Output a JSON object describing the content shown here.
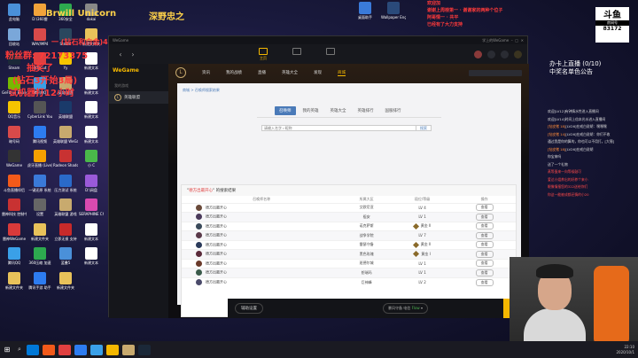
{
  "desktop": {
    "icons": [
      {
        "label": "此电脑",
        "color": "#4a90d9"
      },
      {
        "label": "D:\\360雷",
        "color": "#f2a33a"
      },
      {
        "label": "360安全",
        "color": "#2da94f"
      },
      {
        "label": "dakai",
        "color": "#888"
      },
      {
        "label": "回收站",
        "color": "#7aa7d9"
      },
      {
        "label": "WAV/MP4",
        "color": "#d94a4a"
      },
      {
        "label": "Steam",
        "color": "#2a475e"
      },
      {
        "label": "新建文件夹",
        "color": "#e8c25a"
      },
      {
        "label": "Steam",
        "color": "#1b2838"
      },
      {
        "label": "易看Cut",
        "color": "#e04040"
      },
      {
        "label": "Yy",
        "color": "#f5c400"
      },
      {
        "label": "新建文本",
        "color": "#fff"
      },
      {
        "label": "GeForce Experience",
        "color": "#76b900"
      },
      {
        "label": "腾讯QQ",
        "color": "#3aa0e8"
      },
      {
        "label": "英雄联盟",
        "color": "#c8aa6e"
      },
      {
        "label": "新建文本",
        "color": "#fff"
      },
      {
        "label": "QQ音乐",
        "color": "#f5c400"
      },
      {
        "label": "CyberLink YouCam 7",
        "color": "#555"
      },
      {
        "label": "英雄联盟",
        "color": "#1a3a6a"
      },
      {
        "label": "新建文本",
        "color": "#fff"
      },
      {
        "label": "暗号码",
        "color": "#d94a4a"
      },
      {
        "label": "腾讯视频",
        "color": "#2d7cf0"
      },
      {
        "label": "英雄联盟 WeGame版",
        "color": "#c8aa6e"
      },
      {
        "label": "新建文本",
        "color": "#fff"
      },
      {
        "label": "WeGame",
        "color": "#333"
      },
      {
        "label": "虎牙直播 (Live)",
        "color": "#f5a000"
      },
      {
        "label": "Radeon Shadow",
        "color": "#c83232"
      },
      {
        "label": "小 C",
        "color": "#4ab84a"
      },
      {
        "label": "斗鱼直播伴侣",
        "color": "#f25a1a"
      },
      {
        "label": "一键还原 系统",
        "color": "#3a7ad9"
      },
      {
        "label": "压力测试 系统",
        "color": "#2a6ac9"
      },
      {
        "label": "D:\\网盘",
        "color": "#9a5ad9"
      },
      {
        "label": "雷神科技 控制中心",
        "color": "#c83232"
      },
      {
        "label": "设置",
        "color": "#666"
      },
      {
        "label": "英雄联盟 游戏",
        "color": "#c8aa6e"
      },
      {
        "label": "SERAPHINE Choiha",
        "color": "#d94ab0"
      },
      {
        "label": "雷神WeGame",
        "color": "#d93a3a"
      },
      {
        "label": "新建文件夹",
        "color": "#e8c25a"
      },
      {
        "label": "立即无损 支持",
        "color": "#c82a2a"
      },
      {
        "label": "新建文本",
        "color": "#fff"
      },
      {
        "label": "腾讯QQ",
        "color": "#3aa0e8"
      },
      {
        "label": "360压缩 加速",
        "color": "#2da94f"
      },
      {
        "label": "蓝叠5",
        "color": "#4a90d9"
      },
      {
        "label": "新建文本",
        "color": "#fff"
      },
      {
        "label": "新建文件夹",
        "color": "#e8c25a"
      },
      {
        "label": "腾讯手游 助手",
        "color": "#2d7cf0"
      },
      {
        "label": "新建文件夹",
        "color": "#e8c25a"
      }
    ],
    "right_icons": [
      {
        "label": "桌面助手",
        "color": "#3a7ad9"
      },
      {
        "label": "Wallpaper Engine",
        "color": "#2a4a7a"
      }
    ]
  },
  "overlay": {
    "line1": "Brwill  Unicorn",
    "line2": "深野忠之",
    "line3": "斗鱼",
    "line4": "粉丝群: 72173375",
    "line5": "抽奖了",
    "line6": "(钻石3开始3局)",
    "line7": "试机器打12小时",
    "line8": "新手必看",
    "top_notice": "一 (钻石和白金)4",
    "fans_notice": [
      "欢迎加",
      "谢谢上周榜第一 · 谢谢家的两种个位子",
      "阿哥情一 · 共平",
      "已经有了大力支持"
    ]
  },
  "wegame": {
    "title": "WeGame",
    "window_user": "学上的WeGame",
    "nav": {
      "back": "‹",
      "forward": "›"
    },
    "tabs": [
      {
        "label": "主页",
        "active": true
      },
      {
        "label": "",
        "active": false
      },
      {
        "label": "",
        "active": false
      }
    ],
    "side": {
      "brand": "WeGame",
      "section": "我的游戏",
      "game": "英雄联盟"
    },
    "lol_menu": {
      "items": [
        "资讯",
        "我的战绩",
        "直播",
        "英雄大全",
        "发现",
        "商城"
      ],
      "active_index": 5
    },
    "panel": {
      "breadcrumb": "商城 > 召唤师搜索结果",
      "subtabs": [
        "召唤师",
        "我的英雄",
        "英雄大全",
        "英雄排行",
        "国服排行"
      ],
      "active_subtab": 0,
      "search_placeholder": "请输入名字 • 昵称",
      "search_button": "搜索",
      "result_title_prefix": "\"",
      "query": "德方出最开心",
      "result_title_suffix": "\" 的搜索结果",
      "columns": [
        "召唤师名称",
        "所属大区",
        "段位/等级",
        "操作"
      ],
      "rows": [
        {
          "name": "德方出最开心",
          "region": "艾欧尼亚",
          "rank": "LV 4",
          "has_rank_icon": false,
          "avatar": "#6a4a3a",
          "action": "查看"
        },
        {
          "name": "德方出最开心",
          "region": "祖安",
          "rank": "LV 1",
          "has_rank_icon": false,
          "avatar": "#4a3a5a",
          "action": "查看"
        },
        {
          "name": "德方出最开心",
          "region": "诺克萨斯",
          "rank": "黄金 II",
          "has_rank_icon": true,
          "avatar": "#3a4a5a",
          "action": "查看"
        },
        {
          "name": "德方出最开心",
          "region": "战争学院",
          "rank": "LV 7",
          "has_rank_icon": false,
          "avatar": "#5a3a4a",
          "action": "查看"
        },
        {
          "name": "德方出最开心",
          "region": "雷瑟守备",
          "rank": "黄金 II",
          "has_rank_icon": true,
          "avatar": "#2a3a5a",
          "action": "查看"
        },
        {
          "name": "德方出最开心",
          "region": "黑色玫瑰",
          "rank": "黄金 I",
          "has_rank_icon": true,
          "avatar": "#5a2a3a",
          "action": "查看"
        },
        {
          "name": "德方出最开心",
          "region": "班德尔城",
          "rank": "LV 1",
          "has_rank_icon": false,
          "avatar": "#6a3a2a",
          "action": "查看"
        },
        {
          "name": "德方出最开心",
          "region": "恕瑞玛",
          "rank": "LV 1",
          "has_rank_icon": false,
          "avatar": "#3a5a4a",
          "action": "查看"
        },
        {
          "name": "德方出最开心",
          "region": "巨神峰",
          "rank": "LV 2",
          "has_rank_icon": false,
          "avatar": "#4a4a6a",
          "action": "查看"
        }
      ]
    },
    "footer": {
      "assist": "辅助设置",
      "region": "暴风守备",
      "region_status": "电信",
      "region_ok": "Flow",
      "start": "启动"
    }
  },
  "stream": {
    "platform": "斗鱼",
    "room_label": "房间号",
    "room_no": "83172",
    "announce1": "办卡上直播 (0/10)",
    "announce2": "中奖名单色公告",
    "messages": [
      {
        "u": "",
        "t": "欢迎[LV12]有钟情水性进入直播间"
      },
      {
        "u": "",
        "t": "欢迎[LV14]时间上倍本光水进入直播间"
      },
      {
        "u": "[钻皮猪 18]",
        "t": "[LV26]在戒白说胡：嘿嘿嘿"
      },
      {
        "u": "[钻皮猪 14]",
        "t": "[LV26]在戒白说胡：你们不收"
      },
      {
        "u": "",
        "t": "通过我是你的算的，你也可以不用打。[大锤]"
      },
      {
        "u": "[钻皮猪 18]",
        "t": "[LV26]在戒白说胡"
      },
      {
        "u": "",
        "t": "你宝来吗"
      },
      {
        "u": "",
        "t": "送了一个礼物"
      },
      {
        "u": "",
        "t": ""
      },
      {
        "u": "",
        "t": "蒸等蛋来一向等候鼓可"
      },
      {
        "u": "",
        "t": "爱达小姐养出的好养个来小"
      },
      {
        "u": "",
        "t": "眼像情报您的322送给你们"
      },
      {
        "u": "",
        "t": "你这一能被成都还情的小20"
      }
    ]
  },
  "taskbar": {
    "time": "22:10",
    "date": "2020/10/1",
    "apps": [
      "#0078d7",
      "#f25a1a",
      "#e04040",
      "#2d7cf0",
      "#3aa0e8",
      "#f5b800",
      "#c8aa6e",
      "#1b2838"
    ]
  }
}
